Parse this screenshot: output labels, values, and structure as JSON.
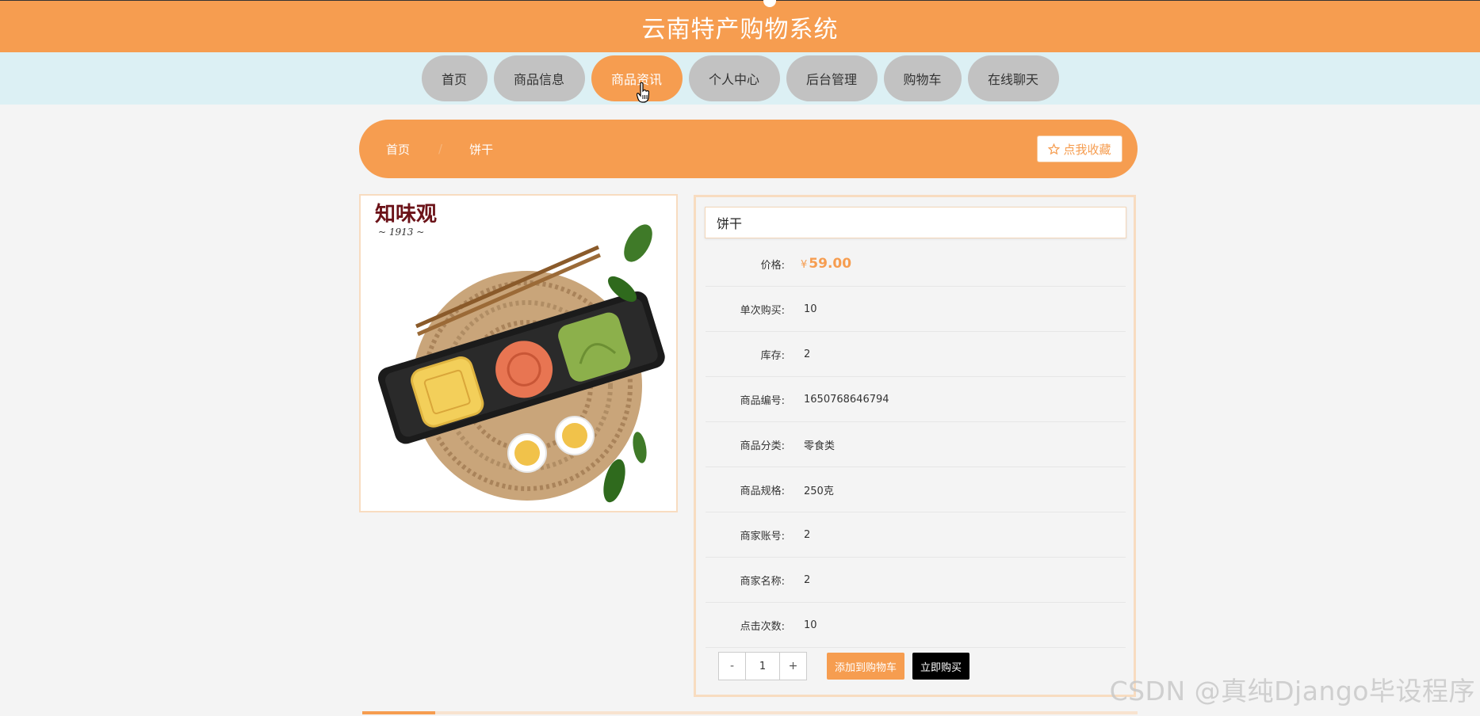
{
  "app": {
    "title": "云南特产购物系统"
  },
  "nav": {
    "items": [
      {
        "label": "首页"
      },
      {
        "label": "商品信息"
      },
      {
        "label": "商品资讯",
        "active": true
      },
      {
        "label": "个人中心"
      },
      {
        "label": "后台管理"
      },
      {
        "label": "购物车"
      },
      {
        "label": "在线聊天"
      }
    ]
  },
  "breadcrumb": {
    "home": "首页",
    "separator": "/",
    "current": "饼干",
    "favorite_label": "点我收藏"
  },
  "product": {
    "brand_text": "知味观",
    "brand_year": "~ 1913 ~",
    "name": "饼干",
    "currency": "¥",
    "price": "59.00",
    "fields": {
      "price_label": "价格:",
      "single_buy_label": "单次购买:",
      "single_buy": "10",
      "stock_label": "库存:",
      "stock": "2",
      "code_label": "商品编号:",
      "code": "1650768646794",
      "category_label": "商品分类:",
      "category": "零食类",
      "spec_label": "商品规格:",
      "spec": "250克",
      "merchant_account_label": "商家账号:",
      "merchant_account": "2",
      "merchant_name_label": "商家名称:",
      "merchant_name": "2",
      "clicks_label": "点击次数:",
      "clicks": "10"
    },
    "quantity": {
      "minus": "-",
      "value": "1",
      "plus": "+"
    },
    "add_to_cart": "添加到购物车",
    "buy_now": "立即购买"
  },
  "watermark": "CSDN @真纯Django毕设程序",
  "colors": {
    "accent": "#f69d50",
    "nav_band": "#dcf0f4",
    "nav_pill": "#c2c2c2",
    "border_light": "#f8dcc0"
  }
}
